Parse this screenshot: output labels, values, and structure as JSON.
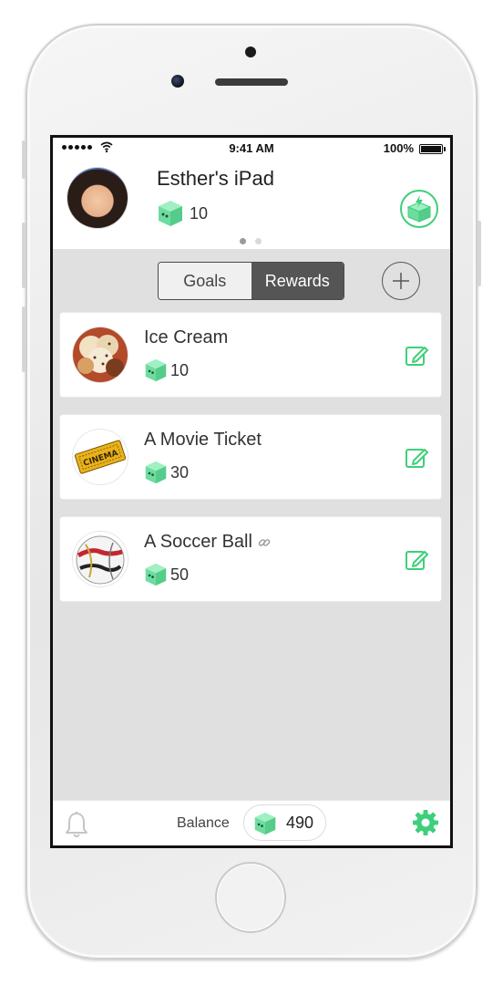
{
  "status_bar": {
    "time": "9:41 AM",
    "battery_percent": "100%"
  },
  "header": {
    "device_name": "Esther's iPad",
    "points": "10",
    "page_indicator": {
      "pages": 2,
      "active_index": 0
    }
  },
  "tabs": {
    "goals": "Goals",
    "rewards": "Rewards",
    "selected": "Rewards"
  },
  "rewards": [
    {
      "title": "Ice Cream",
      "points": "10",
      "linked": false
    },
    {
      "title": "A Movie Ticket",
      "points": "30",
      "linked": false
    },
    {
      "title": "A Soccer Ball",
      "points": "50",
      "linked": true
    }
  ],
  "footer": {
    "balance_label": "Balance",
    "balance_value": "490"
  },
  "colors": {
    "accent_green": "#3ecf7a",
    "cube_green": "#74e0a6",
    "selected_tab": "#555555"
  },
  "icons": [
    "cube-icon",
    "charge-cube-icon",
    "plus-icon",
    "edit-icon",
    "link-icon",
    "bell-icon",
    "gear-icon"
  ]
}
